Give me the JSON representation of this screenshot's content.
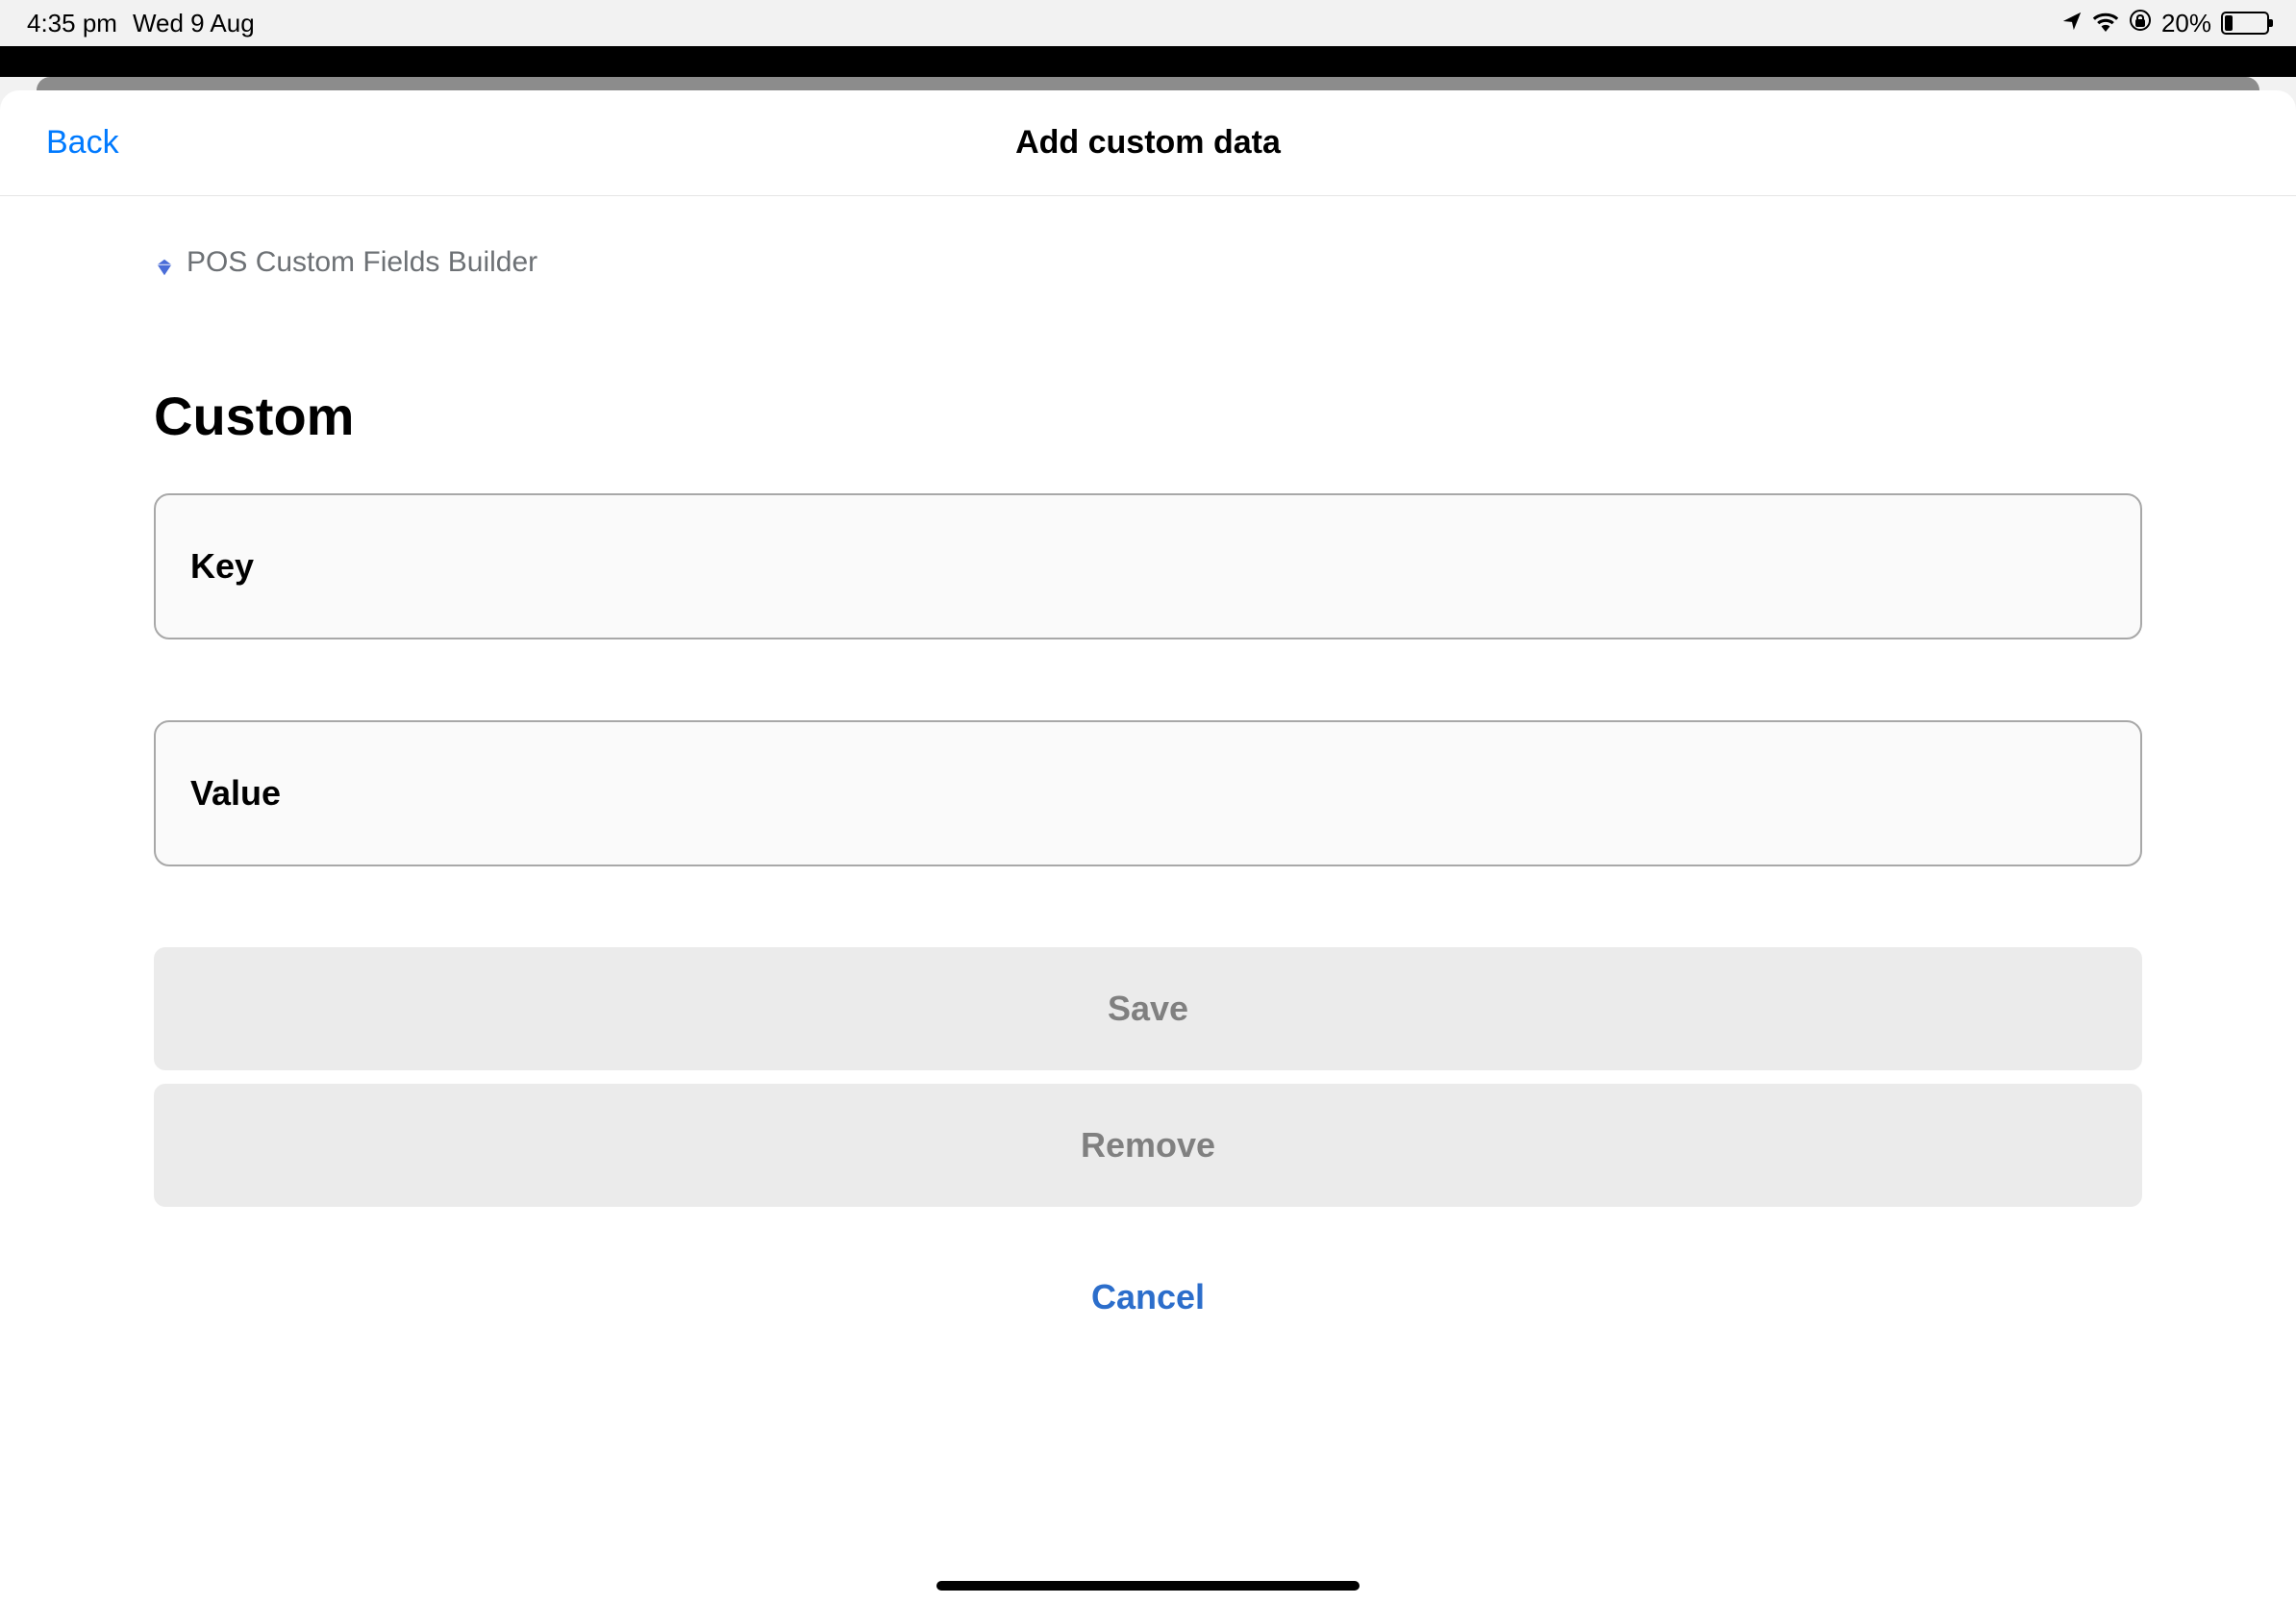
{
  "status_bar": {
    "time": "4:35 pm",
    "date": "Wed 9 Aug",
    "battery_percent": "20%"
  },
  "modal": {
    "back_label": "Back",
    "title": "Add custom data"
  },
  "app_label": "POS Custom Fields Builder",
  "section_title": "Custom",
  "inputs": {
    "key_placeholder": "Key",
    "key_value": "",
    "value_placeholder": "Value",
    "value_value": ""
  },
  "buttons": {
    "save": "Save",
    "remove": "Remove",
    "cancel": "Cancel"
  }
}
